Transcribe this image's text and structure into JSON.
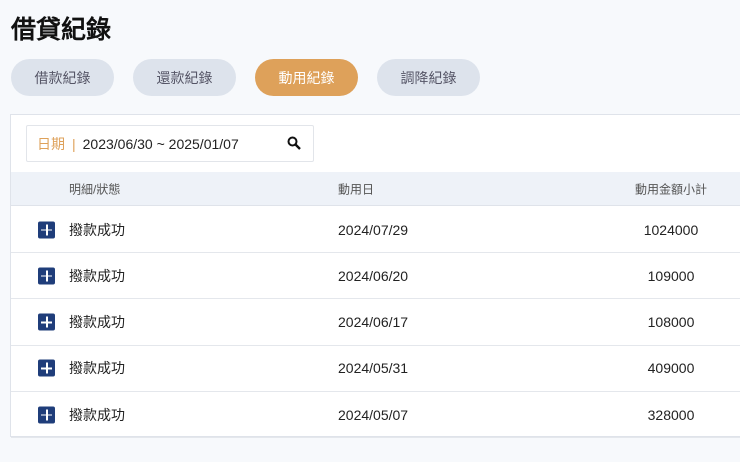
{
  "title": "借貸紀錄",
  "tabs": [
    {
      "label": "借款紀錄"
    },
    {
      "label": "還款紀錄"
    },
    {
      "label": "動用紀錄"
    },
    {
      "label": "調降紀錄"
    }
  ],
  "active_tab": "動用紀錄",
  "search": {
    "label": "日期",
    "separator": "|",
    "value": "2023/06/30 ~ 2025/01/07",
    "icon": "search-icon"
  },
  "table": {
    "headers": [
      "明細/狀態",
      "動用日",
      "動用金額小計"
    ],
    "rows": [
      {
        "status": "撥款成功",
        "date": "2024/07/29",
        "amount": "1024000"
      },
      {
        "status": "撥款成功",
        "date": "2024/06/20",
        "amount": "109000"
      },
      {
        "status": "撥款成功",
        "date": "2024/06/17",
        "amount": "108000"
      },
      {
        "status": "撥款成功",
        "date": "2024/05/31",
        "amount": "409000"
      },
      {
        "status": "撥款成功",
        "date": "2024/05/07",
        "amount": "328000"
      }
    ]
  },
  "colors": {
    "accent": "#dea15a",
    "expand": "#1f3d7a",
    "tab_inactive": "#dde3ec"
  }
}
